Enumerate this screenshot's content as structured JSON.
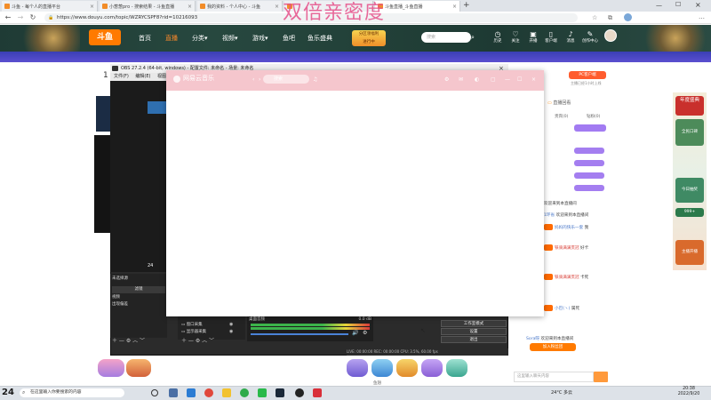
{
  "browser": {
    "tabs": [
      {
        "title": "斗鱼 - 每个人的直播平台",
        "active": false
      },
      {
        "title": "小葱葱pro - 搜索结果 - 斗鱼直播",
        "active": false
      },
      {
        "title": "我的资料 - 个人中心 - 斗鱼",
        "active": false
      },
      {
        "title": "",
        "active": false
      },
      {
        "title": "斗鱼直播_斗鱼直播",
        "active": true
      }
    ],
    "new_tab": "+",
    "url": "https://www.douyu.com/topic/WZRYCSPF8?rid=10216093",
    "watermark": "双倍亲密度"
  },
  "site": {
    "logo": "斗鱼",
    "nav": [
      {
        "label": "首页",
        "active": false
      },
      {
        "label": "直播",
        "active": true
      },
      {
        "label": "分类▾",
        "active": false
      },
      {
        "label": "视频▾",
        "active": false
      },
      {
        "label": "游戏▾",
        "active": false
      },
      {
        "label": "鱼吧",
        "active": false
      },
      {
        "label": "鱼乐盛典",
        "active": false
      }
    ],
    "promo_text": "分区领福利",
    "promo_sub": "进行中",
    "search_placeholder": "搜索",
    "header_icons": [
      {
        "label": "历史",
        "icon": "clock-icon"
      },
      {
        "label": "关注",
        "icon": "heart-icon"
      },
      {
        "label": "开播",
        "icon": "camera-icon"
      },
      {
        "label": "客户端",
        "icon": "phone-icon"
      },
      {
        "label": "消息",
        "icon": "bell-icon"
      },
      {
        "label": "创作中心",
        "icon": "pen-icon"
      }
    ]
  },
  "page": {
    "room_no": "1",
    "pc_client_btn": "PC客户端",
    "pc_client_sub": "主播已经1小时上线",
    "back_to_live": "直播回看",
    "tab_rank": "贵宾(0)",
    "tab_fans": "钻粉(0)",
    "chat": [
      {
        "user": "",
        "text": "欢迎来到本直播间"
      },
      {
        "user": "1环省",
        "text": "欢迎来到本直播间"
      },
      {
        "user": "",
        "text": "欢迎来到本直播间"
      },
      {
        "user": "妈妈的快乐一套",
        "text": "我"
      },
      {
        "user": "铁骑满满贯冠",
        "text": "好卡"
      },
      {
        "user": "铁骑满满贯冠",
        "text": "卡死"
      },
      {
        "user": "小巴(ヽ(",
        "text": "属死"
      },
      {
        "user": "Sora呀",
        "text": "欢迎来到本直播间"
      }
    ],
    "chat_btn": "加入粉丝团",
    "chat_input_placeholder": "这里输入聊天内容",
    "side_ads": [
      "年度盛典",
      "全民口碑",
      "今日抽奖",
      "999+",
      "主播开播"
    ],
    "bottom_gift_label": "鱼翅"
  },
  "obs": {
    "title": "OBS 27.2.4 (64-bit, windows) - 配置文件: 未命名 - 场景: 未命名",
    "menu": [
      "文件(F)",
      "编辑(E)",
      "视图(V)",
      "配置文件(P)",
      "场景集合(S)",
      "工具(T)",
      "帮助(H)"
    ],
    "no_source": "未选择源",
    "filters_label": "滤镜",
    "scene_items": [
      "视频",
      "出现偏差"
    ],
    "sources": [
      "窗口采集",
      "显示器采集"
    ],
    "mixer_label": "桌面音频",
    "mixer_db": "0.0 dB",
    "controls": [
      "工作室模式",
      "设置",
      "退出"
    ],
    "status": "LIVE: 00:00:00   REC: 00:00:00   CPU: 3.5%, 60.00 fps"
  },
  "music": {
    "title": "网易云音乐",
    "search_placeholder": "搜索"
  },
  "taskbar": {
    "search": "在这里输入你要搜索的内容",
    "weather": "24°C 多云",
    "time": "20:38",
    "date": "2022/9/20"
  },
  "colors": {
    "accent": "#ff7a00",
    "header_bg": "#223f38",
    "music_header": "#f5c6cd",
    "watermark": "#e6508a"
  }
}
